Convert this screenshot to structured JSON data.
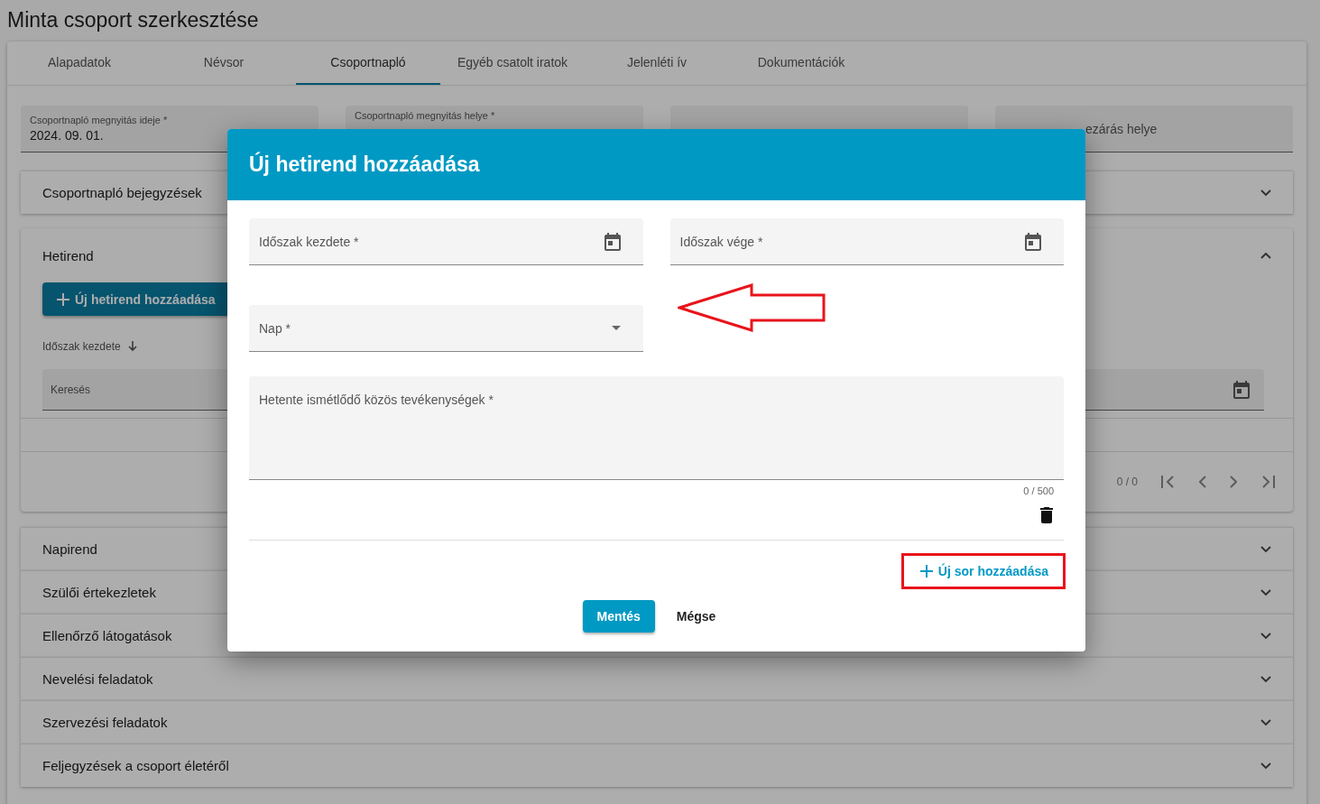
{
  "page_title": "Minta csoport szerkesztése",
  "tabs": [
    {
      "label": "Alapadatok",
      "selected": false
    },
    {
      "label": "Névsor",
      "selected": false
    },
    {
      "label": "Csoportnapló",
      "selected": true
    },
    {
      "label": "Egyéb csatolt iratok",
      "selected": false
    },
    {
      "label": "Jelenléti ív",
      "selected": false
    },
    {
      "label": "Dokumentációk",
      "selected": false
    }
  ],
  "fields": [
    {
      "kind": "filled",
      "label": "Csoportnapló megnyitás ideje *",
      "value": "2024. 09. 01."
    },
    {
      "kind": "label",
      "label": "Csoportnapló megnyitás helye *"
    },
    {
      "kind": "empty"
    },
    {
      "kind": "clipped",
      "label": "ezárás helye"
    }
  ],
  "sections": [
    {
      "title": "Csoportnapló bejegyzések",
      "expanded": false
    },
    {
      "title": "Hetirend",
      "expanded": true,
      "add_button": "Új hetirend hozzáadása",
      "sort_column": "Időszak kezdete",
      "search": {
        "placeholder": "Keresés"
      },
      "pagination": "0 / 0"
    },
    {
      "title": "Napirend",
      "expanded": false
    },
    {
      "title": "Szülői értekezletek",
      "expanded": false
    },
    {
      "title": "Ellenőrző látogatások",
      "expanded": false
    },
    {
      "title": "Nevelési feladatok",
      "expanded": false
    },
    {
      "title": "Szervezési feladatok",
      "expanded": false
    },
    {
      "title": "Feljegyzések a csoport életéről",
      "expanded": false
    }
  ],
  "dialog": {
    "title": "Új hetirend hozzáadása",
    "fields": [
      {
        "kind": "date",
        "label": "Időszak kezdete *"
      },
      {
        "kind": "date",
        "label": "Időszak vége *"
      },
      {
        "kind": "select",
        "label": "Nap *",
        "pointed_at": true
      },
      {
        "kind": "textarea",
        "label": "Hetente ismétlődő közös tevékenységek *",
        "counter": "0 / 500"
      }
    ],
    "add_row_button": "Új sor hozzáadása",
    "add_row_highlighted": true,
    "buttons": [
      {
        "kind": "primary",
        "label": "Mentés"
      },
      {
        "kind": "text",
        "label": "Mégse"
      }
    ]
  }
}
